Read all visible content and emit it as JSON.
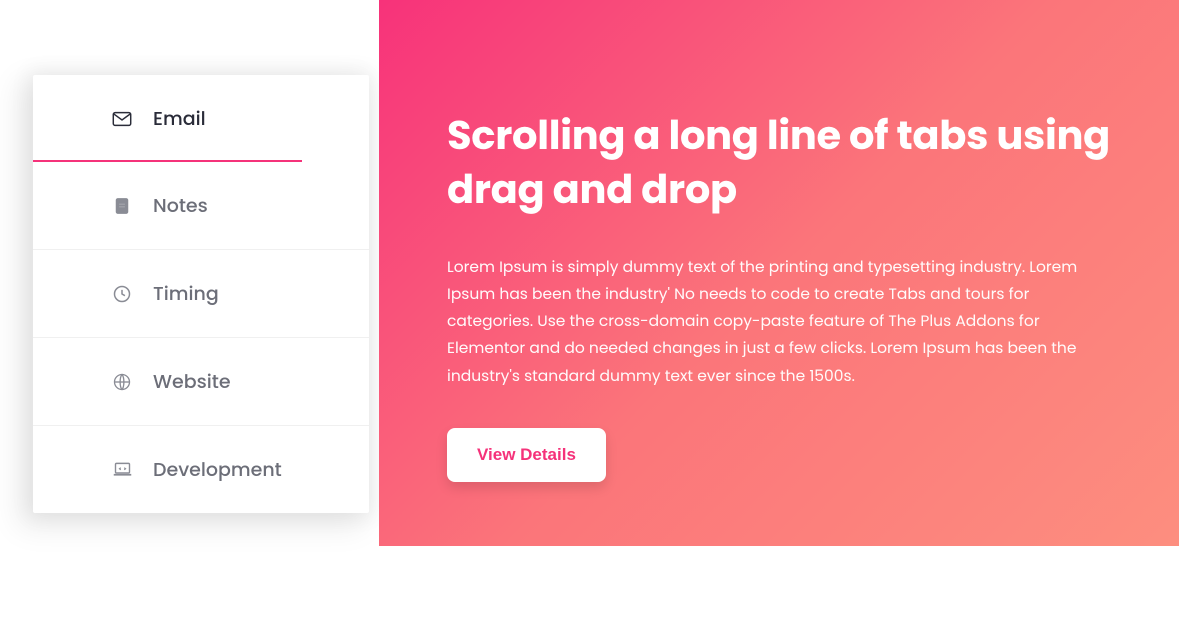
{
  "sidebar": {
    "tabs": [
      {
        "label": "Email",
        "icon": "envelope-icon",
        "active": true
      },
      {
        "label": "Notes",
        "icon": "notes-icon",
        "active": false
      },
      {
        "label": "Timing",
        "icon": "clock-icon",
        "active": false
      },
      {
        "label": "Website",
        "icon": "globe-icon",
        "active": false
      },
      {
        "label": "Development",
        "icon": "laptop-icon",
        "active": false
      }
    ]
  },
  "content": {
    "title": "Scrolling a long line of tabs using drag and drop",
    "body": "Lorem Ipsum is simply dummy text of the printing and typesetting industry. Lorem Ipsum has been the industry' No needs to code to create Tabs and tours for categories. Use the cross-domain copy-paste feature of The Plus Addons for Elementor and do needed changes in just a few clicks. Lorem Ipsum has been the industry's standard dummy text ever since the 1500s.",
    "button_label": "View Details"
  },
  "colors": {
    "accent": "#f5327a",
    "gradient_start": "#f7327a",
    "gradient_end": "#fd8e7f"
  }
}
